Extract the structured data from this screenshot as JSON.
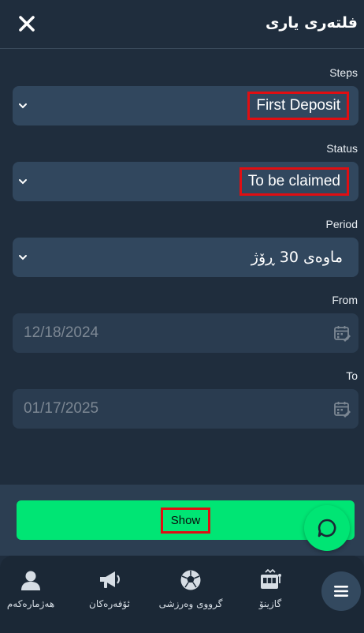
{
  "header": {
    "title": "فلتەری یاری"
  },
  "filters": {
    "steps": {
      "label": "Steps",
      "value": "First Deposit"
    },
    "status": {
      "label": "Status",
      "value": "To be claimed"
    },
    "period": {
      "label": "Period",
      "value": "ماوەی 30 ڕۆژ"
    },
    "from": {
      "label": "From",
      "value": "12/18/2024"
    },
    "to": {
      "label": "To",
      "value": "01/17/2025"
    }
  },
  "actions": {
    "show_label": "Show"
  },
  "bottom_nav": {
    "items": [
      {
        "label": "هەژمارەکەم",
        "icon": "user-icon"
      },
      {
        "label": "ئۆفەرەکان",
        "icon": "megaphone-icon"
      },
      {
        "label": "گرووی وەرزشی",
        "icon": "soccer-ball-icon"
      },
      {
        "label": "گازینۆ",
        "icon": "slot-machine-icon"
      }
    ],
    "menu_icon": "hamburger-menu-icon"
  },
  "colors": {
    "background": "#1f2d3d",
    "select_bg": "#31475e",
    "date_bg": "#2a3c50",
    "accent_green": "#00e574",
    "highlight_red": "#e00e12",
    "nav_bg": "#1b2836"
  }
}
